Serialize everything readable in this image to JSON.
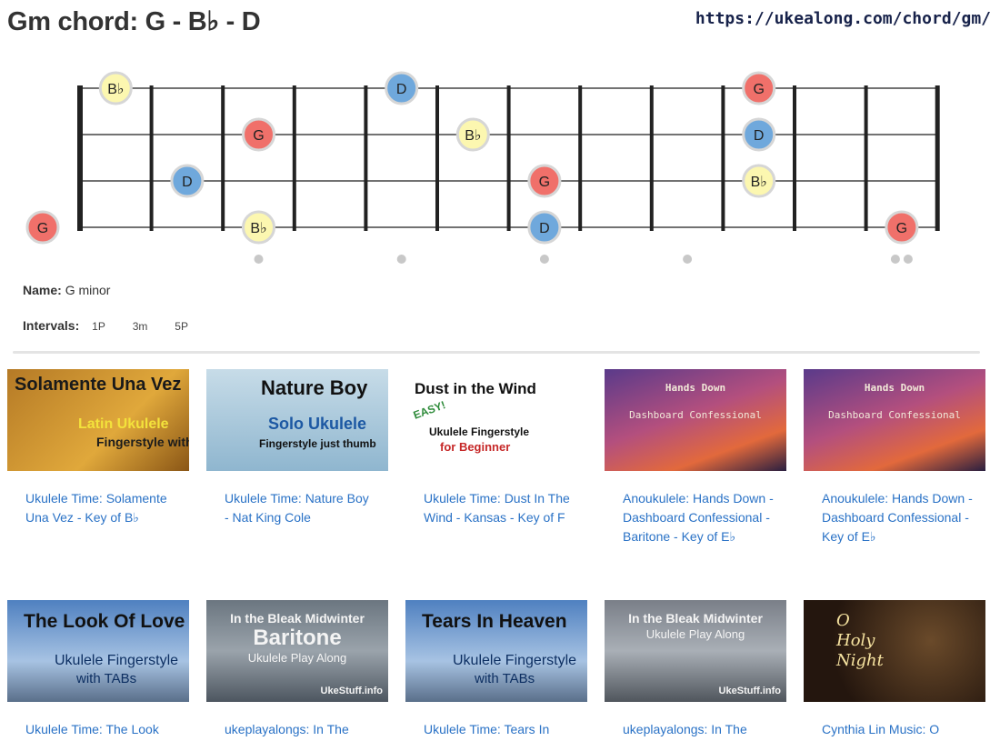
{
  "title": "Gm chord: G - B♭ - D",
  "url": "https://ukealong.com/chord/gm/",
  "fretboard": {
    "frets": 12,
    "strings": 4,
    "notes": [
      {
        "string": 1,
        "fret": 1,
        "label": "B♭",
        "color": "#fcf7b0"
      },
      {
        "string": 1,
        "fret": 5,
        "label": "D",
        "color": "#6fa8dc"
      },
      {
        "string": 1,
        "fret": 10,
        "label": "G",
        "color": "#f0706a"
      },
      {
        "string": 2,
        "fret": 3,
        "label": "G",
        "color": "#f0706a"
      },
      {
        "string": 2,
        "fret": 6,
        "label": "B♭",
        "color": "#fcf7b0"
      },
      {
        "string": 2,
        "fret": 10,
        "label": "D",
        "color": "#6fa8dc"
      },
      {
        "string": 3,
        "fret": 2,
        "label": "D",
        "color": "#6fa8dc"
      },
      {
        "string": 3,
        "fret": 7,
        "label": "G",
        "color": "#f0706a"
      },
      {
        "string": 3,
        "fret": 10,
        "label": "B♭",
        "color": "#fcf7b0"
      },
      {
        "string": 4,
        "fret": 0,
        "label": "G",
        "color": "#f0706a"
      },
      {
        "string": 4,
        "fret": 3,
        "label": "B♭",
        "color": "#fcf7b0"
      },
      {
        "string": 4,
        "fret": 7,
        "label": "D",
        "color": "#6fa8dc"
      },
      {
        "string": 4,
        "fret": 12,
        "label": "G",
        "color": "#f0706a"
      }
    ],
    "inlays": [
      3,
      5,
      7,
      9
    ],
    "double_inlay": 12
  },
  "info": {
    "name_label": "Name:",
    "name_value": "G minor",
    "intervals_label": "Intervals:",
    "intervals": [
      "1P",
      "3m",
      "5P"
    ]
  },
  "videos": [
    {
      "link": "Ukulele Time: Solamente Una Vez - Key of B♭",
      "thumb": {
        "t1": "Solamente Una Vez",
        "t2": "Latin Ukulele",
        "t3": "Fingerstyle with TABs"
      }
    },
    {
      "link": "Ukulele Time: Nature Boy - Nat King Cole",
      "thumb": {
        "t1": "Nature Boy",
        "t2": "Solo Ukulele",
        "t3": "Fingerstyle just thumb"
      }
    },
    {
      "link": "Ukulele Time: Dust In The Wind - Kansas - Key of F",
      "thumb": {
        "t1": "Dust in the Wind",
        "easy": "EASY!",
        "t2": "Ukulele Fingerstyle",
        "t3": "for Beginner"
      }
    },
    {
      "link": "Anoukulele: Hands Down - Dashboard Confessional - Baritone - Key of E♭",
      "thumb": {
        "t1": "Hands Down",
        "t2": "Dashboard Confessional"
      }
    },
    {
      "link": "Anoukulele: Hands Down - Dashboard Confessional - Key of E♭",
      "thumb": {
        "t1": "Hands Down",
        "t2": "Dashboard Confessional"
      }
    },
    {
      "link": "Ukulele Time: The Look",
      "thumb": {
        "t1": "The Look Of Love",
        "t2": "Ukulele Fingerstyle",
        "t3": "with TABs"
      }
    },
    {
      "link": "ukeplayalongs: In The",
      "thumb": {
        "t1": "In the Bleak Midwinter",
        "t2": "Baritone",
        "t3": "Ukulele Play Along",
        "t4": "UkeStuff.info"
      }
    },
    {
      "link": "Ukulele Time: Tears In",
      "thumb": {
        "t1": "Tears In Heaven",
        "t2": "Ukulele Fingerstyle",
        "t3": "with TABs"
      }
    },
    {
      "link": "ukeplayalongs: In The",
      "thumb": {
        "t1": "In the Bleak Midwinter",
        "t2": "Ukulele Play Along",
        "t4": "UkeStuff.info"
      }
    },
    {
      "link": "Cynthia Lin Music: O",
      "thumb": {
        "t1": "O Holy Night"
      }
    }
  ]
}
